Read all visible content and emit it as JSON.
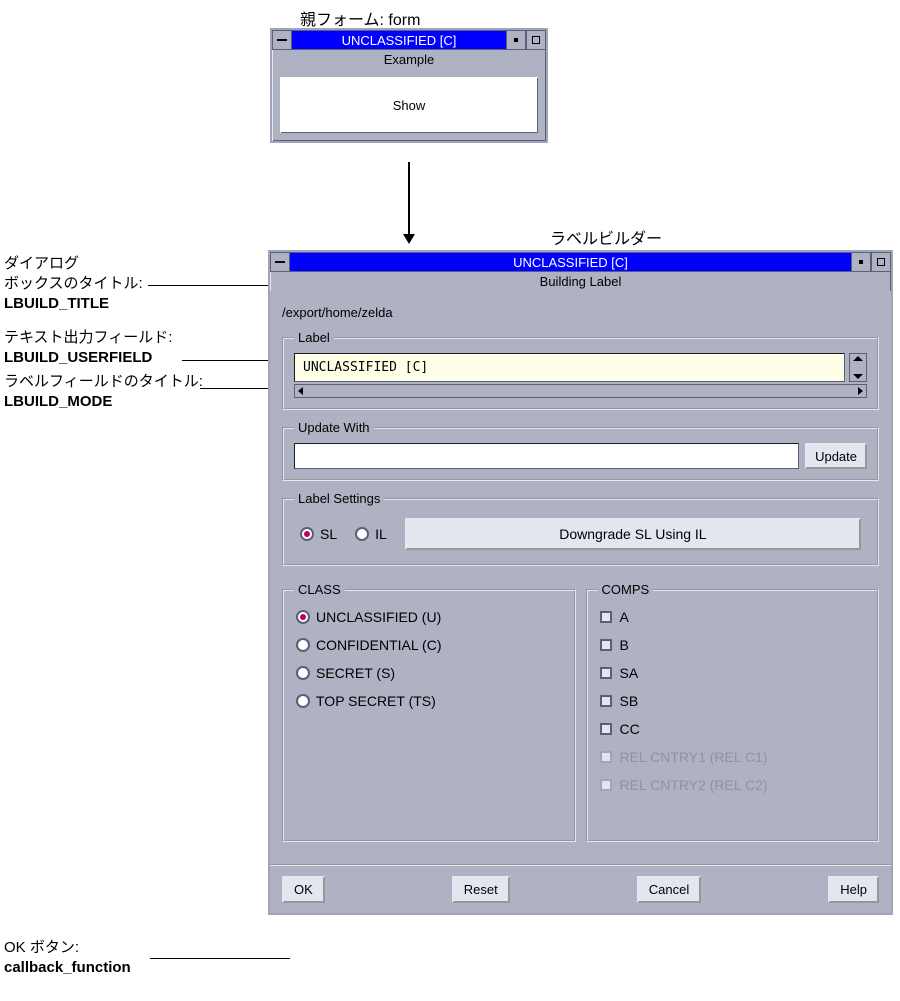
{
  "annotations": {
    "parent_form_heading": "親フォーム: form",
    "label_builder_heading": "ラベルビルダー",
    "dialog_title_label_line1": "ダイアログ",
    "dialog_title_label_line2": "ボックスのタイトル:",
    "dialog_title_const": "LBUILD_TITLE",
    "userfield_label": "テキスト出力フィールド:",
    "userfield_const": "LBUILD_USERFIELD",
    "mode_label": "ラベルフィールドのタイトル:",
    "mode_const": "LBUILD_MODE",
    "ok_label": "OK ボタン:",
    "ok_const": "callback_function"
  },
  "parent_form": {
    "titlebar": "UNCLASSIFIED [C]",
    "subtitle": "Example",
    "button": "Show"
  },
  "dialog": {
    "titlebar": "UNCLASSIFIED [C]",
    "subtitle": "Building Label",
    "path": "/export/home/zelda",
    "label_section_legend": "Label",
    "label_value": "UNCLASSIFIED [C]",
    "update_section_legend": "Update With",
    "update_value": "",
    "update_button": "Update",
    "settings_section_legend": "Label Settings",
    "settings_radios": [
      {
        "label": "SL",
        "selected": true
      },
      {
        "label": "IL",
        "selected": false
      }
    ],
    "downgrade_button": "Downgrade SL Using IL",
    "class_section_legend": "CLASS",
    "class_options": [
      {
        "label": "UNCLASSIFIED (U)",
        "selected": true
      },
      {
        "label": "CONFIDENTIAL (C)",
        "selected": false
      },
      {
        "label": "SECRET (S)",
        "selected": false
      },
      {
        "label": "TOP SECRET (TS)",
        "selected": false
      }
    ],
    "comps_section_legend": "COMPS",
    "comps_options": [
      {
        "label": "A",
        "disabled": false
      },
      {
        "label": "B",
        "disabled": false
      },
      {
        "label": "SA",
        "disabled": false
      },
      {
        "label": "SB",
        "disabled": false
      },
      {
        "label": "CC",
        "disabled": false
      },
      {
        "label": "REL CNTRY1 (REL C1)",
        "disabled": true
      },
      {
        "label": "REL CNTRY2 (REL C2)",
        "disabled": true
      }
    ],
    "buttons": {
      "ok": "OK",
      "reset": "Reset",
      "cancel": "Cancel",
      "help": "Help"
    }
  }
}
